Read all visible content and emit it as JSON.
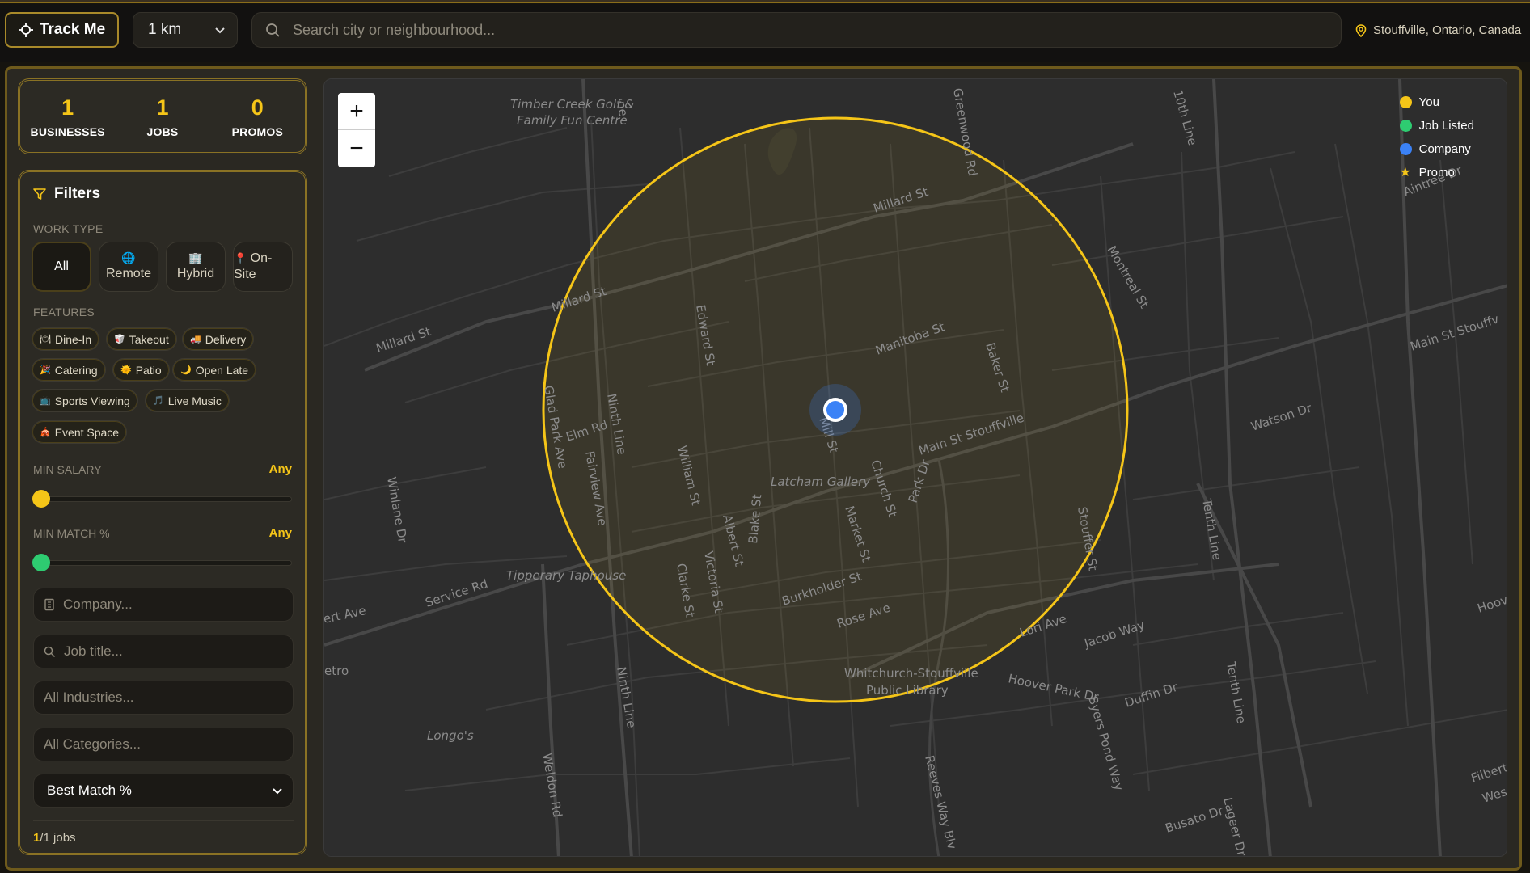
{
  "topbar": {
    "track_label": "Track Me",
    "radius_value": "1 km",
    "search_placeholder": "Search city or neighbourhood...",
    "location": "Stouffville, Ontario, Canada"
  },
  "stats": [
    {
      "value": "1",
      "label": "BUSINESSES"
    },
    {
      "value": "1",
      "label": "JOBS"
    },
    {
      "value": "0",
      "label": "PROMOS"
    }
  ],
  "filters": {
    "title": "Filters",
    "work_type_label": "WORK TYPE",
    "work_types": [
      {
        "icon": "",
        "label": "All",
        "active": true
      },
      {
        "icon": "globe-icon",
        "label": "Remote"
      },
      {
        "icon": "building-icon",
        "label": "Hybrid"
      },
      {
        "icon": "pin-icon",
        "label": "On-Site"
      }
    ],
    "features_label": "FEATURES",
    "features": [
      {
        "icon": "dine-in-icon",
        "label": "Dine-In"
      },
      {
        "icon": "takeout-icon",
        "label": "Takeout"
      },
      {
        "icon": "delivery-icon",
        "label": "Delivery"
      },
      {
        "icon": "catering-icon",
        "label": "Catering"
      },
      {
        "icon": "patio-icon",
        "label": "Patio"
      },
      {
        "icon": "moon-icon",
        "label": "Open Late"
      },
      {
        "icon": "tv-icon",
        "label": "Sports Viewing"
      },
      {
        "icon": "music-icon",
        "label": "Live Music"
      },
      {
        "icon": "event-icon",
        "label": "Event Space"
      }
    ],
    "min_salary_label": "MIN SALARY",
    "min_salary_value": "Any",
    "min_salary_fraction": 0,
    "min_match_label": "MIN MATCH %",
    "min_match_value": "Any",
    "min_match_fraction": 0,
    "company_placeholder": "Company...",
    "job_title_placeholder": "Job title...",
    "industries_placeholder": "All Industries...",
    "categories_placeholder": "All Categories...",
    "sort_value": "Best Match %",
    "count_shown": "1",
    "count_total": "/1 jobs"
  },
  "map": {
    "zoom_in": "+",
    "zoom_out": "−",
    "legend": [
      {
        "label": "You",
        "color": "#f5c518",
        "shape": "dot"
      },
      {
        "label": "Job Listed",
        "color": "#2ecc71",
        "shape": "dot"
      },
      {
        "label": "Company",
        "color": "#3b82f6",
        "shape": "dot"
      },
      {
        "label": "Promo",
        "color": "#f5c518",
        "shape": "star"
      }
    ],
    "labels": {
      "timber_creek_1": "Timber Creek Golf &",
      "timber_creek_2": "Family Fun Centre",
      "millard_1": "Millard St",
      "millard_2": "Millard St",
      "millard_3": "Millard St",
      "greenwood": "Greenwood Rd",
      "tenth_top": "10th Line",
      "aintree": "Aintree Dr",
      "montreal": "Montreal St",
      "main_east": "Main St Stouffv",
      "edward": "Edward St",
      "manitoba": "Manitoba St",
      "baker": "Baker St",
      "glad_park": "Glad Park Ave",
      "elm": "Elm Rd",
      "ninth_1": "Ninth Line",
      "mill": "Mill St",
      "main_center": "Main St Stouffville",
      "watson": "Watson Dr",
      "winlane": "Winlane Dr",
      "fairview": "Fairview Ave",
      "william": "William St",
      "church": "Church St",
      "park": "Park Dr",
      "latcham": "Latcham Gallery",
      "albert": "Albert St",
      "market": "Market St",
      "stouffer": "Stouffer St",
      "tenth_1": "Tenth Line",
      "tipperary": "Tipperary Taphouse",
      "clarke": "Clarke St",
      "victoria": "Victoria St",
      "blake": "Blake St",
      "burkholder": "Burkholder St",
      "service": "Service Rd",
      "ert": "ert Ave",
      "rose": "Rose Ave",
      "lori": "Lori Ave",
      "jacob": "Jacob Way",
      "hoov": "Hoov",
      "etro": "etro",
      "ninth_2": "Ninth Line",
      "library_1": "Whitchurch-Stouffville",
      "library_2": "Public Library",
      "hoover": "Hoover Park Dr",
      "byers": "Byers Pond Way",
      "duffin": "Duffin Dr",
      "tenth_2": "Tenth Line",
      "longos": "Longo's",
      "weldon": "Weldon Rd",
      "reeves": "Reeves Way Blv",
      "busato": "Busato Dr",
      "lageer": "Lageer Dr",
      "filbert": "Filbert C",
      "wes": "Wes",
      "line_e": "ne"
    }
  }
}
